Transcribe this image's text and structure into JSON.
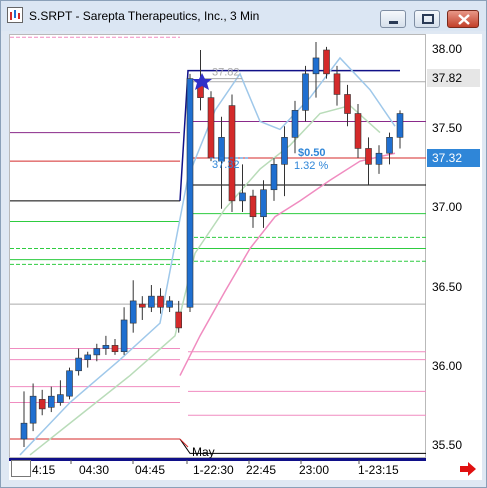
{
  "window": {
    "title": "S.SRPT - Sarepta Therapeutics, Inc., 3 Min",
    "buttons": {
      "minimize": "minimize",
      "maximize": "maximize",
      "close": "close"
    }
  },
  "price_axis": {
    "labels": [
      "38.00",
      "37.50",
      "37.00",
      "36.50",
      "36.00",
      "35.50"
    ],
    "last_price_tag": {
      "text": "37.82",
      "bg": "#e6e6e6",
      "fg": "#000000"
    },
    "current_price_tag": {
      "text": "37.32",
      "bg": "#2f86d8",
      "fg": "#ffffff"
    }
  },
  "time_axis": {
    "labels": [
      "4:15",
      "04:30",
      "04:45",
      "1-22:30",
      "22:45",
      "23:00",
      "1-23:15"
    ]
  },
  "annotations": {
    "entry_price": "37.82",
    "exit_price": "37.32",
    "change_amount": "$0.50",
    "change_percent": "1.32 %",
    "month_label": "May"
  },
  "chart_data": {
    "type": "candlestick",
    "ylim": [
      35.4,
      38.1
    ],
    "candles": [
      {
        "o": 35.55,
        "h": 35.85,
        "l": 35.5,
        "c": 35.65
      },
      {
        "o": 35.65,
        "h": 35.9,
        "l": 35.6,
        "c": 35.82
      },
      {
        "o": 35.8,
        "h": 35.86,
        "l": 35.7,
        "c": 35.74
      },
      {
        "o": 35.75,
        "h": 35.88,
        "l": 35.72,
        "c": 35.82
      },
      {
        "o": 35.78,
        "h": 35.92,
        "l": 35.76,
        "c": 35.83
      },
      {
        "o": 35.82,
        "h": 36.0,
        "l": 35.8,
        "c": 35.98
      },
      {
        "o": 35.98,
        "h": 36.12,
        "l": 35.95,
        "c": 36.06
      },
      {
        "o": 36.05,
        "h": 36.1,
        "l": 36.0,
        "c": 36.08
      },
      {
        "o": 36.08,
        "h": 36.15,
        "l": 36.04,
        "c": 36.12
      },
      {
        "o": 36.12,
        "h": 36.2,
        "l": 36.08,
        "c": 36.14
      },
      {
        "o": 36.14,
        "h": 36.18,
        "l": 36.08,
        "c": 36.1
      },
      {
        "o": 36.1,
        "h": 36.38,
        "l": 36.08,
        "c": 36.3
      },
      {
        "o": 36.28,
        "h": 36.55,
        "l": 36.22,
        "c": 36.42
      },
      {
        "o": 36.4,
        "h": 36.45,
        "l": 36.3,
        "c": 36.38
      },
      {
        "o": 36.38,
        "h": 36.52,
        "l": 36.35,
        "c": 36.45
      },
      {
        "o": 36.45,
        "h": 36.5,
        "l": 36.34,
        "c": 36.38
      },
      {
        "o": 36.38,
        "h": 36.45,
        "l": 36.35,
        "c": 36.42
      },
      {
        "o": 36.35,
        "h": 36.42,
        "l": 36.22,
        "c": 36.25
      },
      {
        "o": 36.38,
        "h": 37.85,
        "l": 36.35,
        "c": 37.82
      },
      {
        "o": 37.8,
        "h": 38.0,
        "l": 37.62,
        "c": 37.7
      },
      {
        "o": 37.7,
        "h": 37.74,
        "l": 37.3,
        "c": 37.32
      },
      {
        "o": 37.3,
        "h": 37.58,
        "l": 37.0,
        "c": 37.45
      },
      {
        "o": 37.65,
        "h": 37.72,
        "l": 36.98,
        "c": 37.05
      },
      {
        "o": 37.05,
        "h": 37.28,
        "l": 36.98,
        "c": 37.1
      },
      {
        "o": 37.08,
        "h": 37.12,
        "l": 36.88,
        "c": 36.95
      },
      {
        "o": 36.95,
        "h": 37.18,
        "l": 36.88,
        "c": 37.12
      },
      {
        "o": 37.12,
        "h": 37.32,
        "l": 37.05,
        "c": 37.28
      },
      {
        "o": 37.28,
        "h": 37.52,
        "l": 37.08,
        "c": 37.45
      },
      {
        "o": 37.45,
        "h": 37.68,
        "l": 37.35,
        "c": 37.62
      },
      {
        "o": 37.62,
        "h": 37.9,
        "l": 37.55,
        "c": 37.85
      },
      {
        "o": 37.85,
        "h": 38.05,
        "l": 37.7,
        "c": 37.95
      },
      {
        "o": 38.0,
        "h": 38.02,
        "l": 37.82,
        "c": 37.85
      },
      {
        "o": 37.85,
        "h": 37.9,
        "l": 37.65,
        "c": 37.72
      },
      {
        "o": 37.72,
        "h": 37.78,
        "l": 37.52,
        "c": 37.6
      },
      {
        "o": 37.6,
        "h": 37.66,
        "l": 37.32,
        "c": 37.38
      },
      {
        "o": 37.38,
        "h": 37.45,
        "l": 37.15,
        "c": 37.28
      },
      {
        "o": 37.28,
        "h": 37.4,
        "l": 37.22,
        "c": 37.35
      },
      {
        "o": 37.35,
        "h": 37.48,
        "l": 37.28,
        "c": 37.45
      },
      {
        "o": 37.45,
        "h": 37.62,
        "l": 37.38,
        "c": 37.6
      }
    ],
    "colors": {
      "up": "#1f6fd0",
      "down": "#d42a2a"
    }
  }
}
